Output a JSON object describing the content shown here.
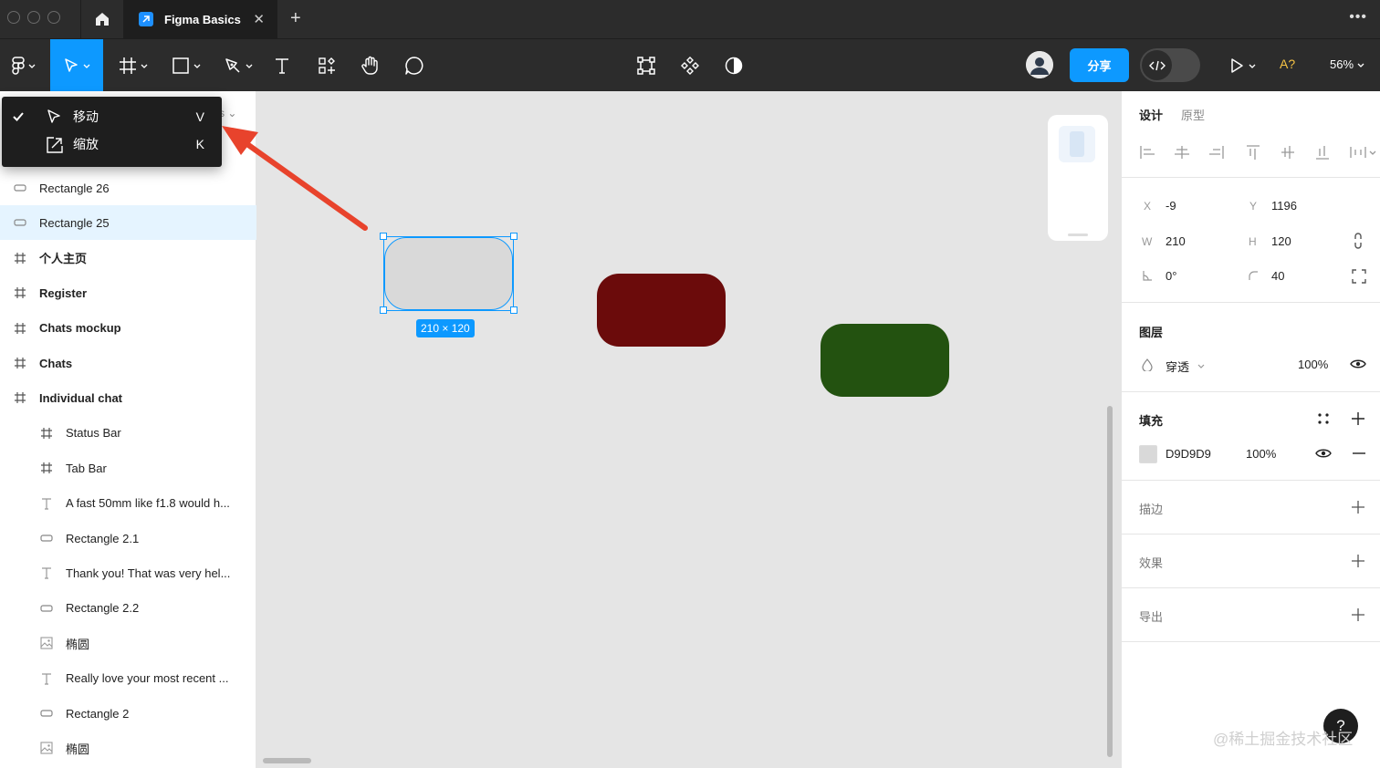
{
  "titlebar": {
    "tab_title": "Figma Basics",
    "close_glyph": "✕",
    "new_tab_glyph": "+",
    "more_glyph": "•••"
  },
  "toolbar": {
    "share_label": "分享",
    "a_label": "A?",
    "zoom_label": "56%",
    "accent": "#0d99ff"
  },
  "move_menu": {
    "items": [
      {
        "label": "移动",
        "shortcut": "V",
        "checked": true,
        "icon": "move-arrow-icon"
      },
      {
        "label": "缩放",
        "shortcut": "K",
        "checked": false,
        "icon": "scale-icon"
      }
    ],
    "hidden_tab_fragment": "s ⌄"
  },
  "layers": [
    {
      "name": "Rectangle 26",
      "icon": "rectangle-icon",
      "indent": 0,
      "bold": false,
      "selected": false
    },
    {
      "name": "Rectangle 25",
      "icon": "rectangle-icon",
      "indent": 0,
      "bold": false,
      "selected": true
    },
    {
      "name": "个人主页",
      "icon": "frame-icon",
      "indent": 0,
      "bold": true,
      "selected": false
    },
    {
      "name": "Register",
      "icon": "frame-icon",
      "indent": 0,
      "bold": true,
      "selected": false
    },
    {
      "name": "Chats mockup",
      "icon": "frame-icon",
      "indent": 0,
      "bold": true,
      "selected": false
    },
    {
      "name": "Chats",
      "icon": "frame-icon",
      "indent": 0,
      "bold": true,
      "selected": false
    },
    {
      "name": "Individual chat",
      "icon": "frame-icon",
      "indent": 0,
      "bold": true,
      "selected": false
    },
    {
      "name": "Status Bar",
      "icon": "frame-icon",
      "indent": 1,
      "bold": false,
      "selected": false
    },
    {
      "name": "Tab Bar",
      "icon": "frame-icon",
      "indent": 1,
      "bold": false,
      "selected": false
    },
    {
      "name": "A fast 50mm like f1.8 would h...",
      "icon": "text-icon",
      "indent": 1,
      "bold": false,
      "selected": false
    },
    {
      "name": "Rectangle 2.1",
      "icon": "rectangle-icon",
      "indent": 1,
      "bold": false,
      "selected": false
    },
    {
      "name": "Thank you! That was very hel...",
      "icon": "text-icon",
      "indent": 1,
      "bold": false,
      "selected": false
    },
    {
      "name": "Rectangle 2.2",
      "icon": "rectangle-icon",
      "indent": 1,
      "bold": false,
      "selected": false
    },
    {
      "name": "椭圆",
      "icon": "image-icon",
      "indent": 1,
      "bold": false,
      "selected": false
    },
    {
      "name": "Really love your most recent ...",
      "icon": "text-icon",
      "indent": 1,
      "bold": false,
      "selected": false
    },
    {
      "name": "Rectangle 2",
      "icon": "rectangle-icon",
      "indent": 1,
      "bold": false,
      "selected": false
    },
    {
      "name": "椭圆",
      "icon": "image-icon",
      "indent": 1,
      "bold": false,
      "selected": false
    }
  ],
  "canvas": {
    "size_badge": "210 × 120",
    "shape_colors": {
      "gray": "#d9d9d9",
      "red": "#6b0b0b",
      "green": "#235210"
    }
  },
  "design_panel": {
    "tabs": {
      "design": "设计",
      "prototype": "原型"
    },
    "x_label": "X",
    "x_value": "-9",
    "y_label": "Y",
    "y_value": "1196",
    "w_label": "W",
    "w_value": "210",
    "h_label": "H",
    "h_value": "120",
    "rotation_value": "0°",
    "radius_value": "40",
    "layer_title": "图层",
    "blend_mode": "穿透",
    "layer_opacity": "100%",
    "fill_title": "填充",
    "fill_hex": "D9D9D9",
    "fill_swatch": "#d9d9d9",
    "fill_opacity": "100%",
    "stroke_title": "描边",
    "effects_title": "效果",
    "export_title": "导出",
    "watermark": "@稀土掘金技术社区",
    "help_glyph": "?"
  }
}
